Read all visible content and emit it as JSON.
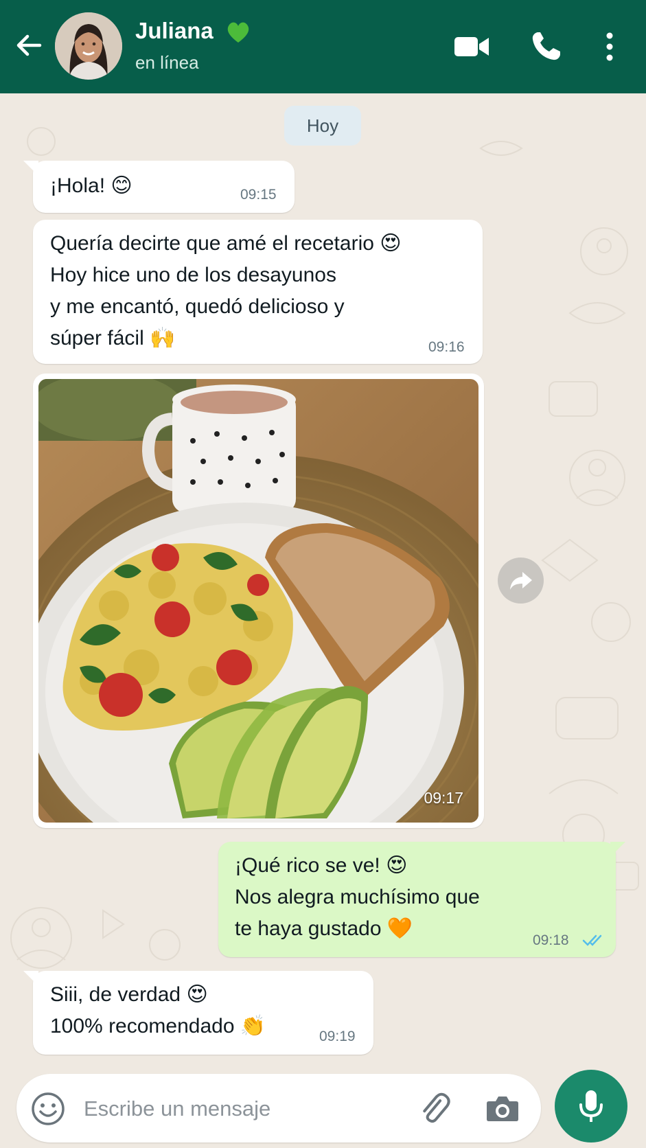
{
  "header": {
    "contact_name": "Juliana",
    "status": "en línea",
    "icons": [
      "back-arrow-icon",
      "green-heart-icon",
      "video-call-icon",
      "phone-icon",
      "more-options-icon"
    ]
  },
  "date_chip": "Hoy",
  "messages": [
    {
      "direction": "in",
      "text": "¡Hola! 😊",
      "time": "09:15"
    },
    {
      "direction": "in",
      "text": "Quería decirte que amé el recetario 😍\nHoy hice uno de los desayunos\ny me encantó, quedó delicioso y\nsúper fácil 🙌",
      "time": "09:16"
    },
    {
      "direction": "in",
      "type": "image",
      "time": "09:17"
    },
    {
      "direction": "out",
      "text": "¡Qué rico se ve! 😍\nNos alegra muchísimo que\nte haya gustado 🧡",
      "time": "09:18",
      "status": "read"
    },
    {
      "direction": "in",
      "text": "Siii, de verdad 😍\n100% recomendado 👏",
      "time": "09:19"
    }
  ],
  "composer": {
    "placeholder": "Escribe un mensaje",
    "value": ""
  },
  "colors": {
    "header": "#075e4a",
    "background": "#efe9e1",
    "outgoing_bubble": "#dbf8c6",
    "incoming_bubble": "#ffffff",
    "mic_button": "#1b8a6b",
    "read_ticks": "#53bdeb"
  }
}
